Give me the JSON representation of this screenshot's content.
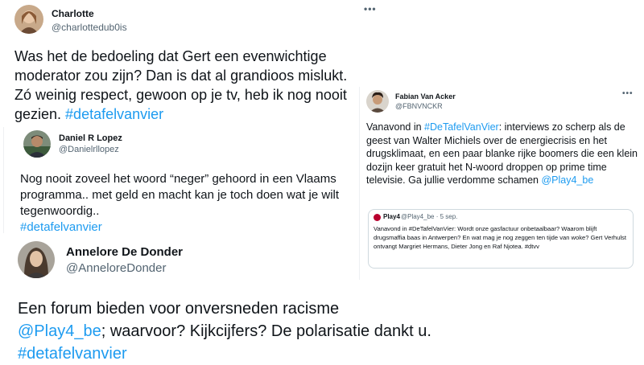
{
  "tweets": {
    "charlotte": {
      "name": "Charlotte",
      "handle": "@charlottedub0is",
      "more": "•••",
      "text_before": "Was het de bedoeling dat Gert een evenwichtige moderator zou zijn? Dan is dat al grandioos mislukt. Zó weinig respect, gewoon op je tv, heb ik nog nooit gezien. ",
      "hashtag": "#detafelvanvier"
    },
    "daniel": {
      "name": "Daniel R Lopez",
      "handle": "@Danielrllopez",
      "text_before": "Nog nooit zoveel het woord “neger” gehoord in een Vlaams programma.. met geld en macht kan je toch doen wat je wilt tegenwoordig..",
      "hashtag": "#detafelvanvier"
    },
    "annelore": {
      "name": "Annelore De Donder",
      "handle": "@AnneloreDonder",
      "text_before": "Een forum bieden voor onversneden racisme ",
      "mention": "@Play4_be",
      "text_after": "; waarvoor? Kijkcijfers? De polarisatie dankt u. ",
      "hashtag": "#detafelvanvier"
    },
    "fabian": {
      "name": "Fabian Van Acker",
      "handle": "@FBNVNCKR",
      "more": "•••",
      "text_before": "Vanavond in ",
      "hashtag": "#DeTafelVanVier",
      "text_middle": ": interviews zo scherp als de geest van Walter Michiels over de energiecrisis en het drugsklimaat, en een paar blanke rijke boomers die een klein dozijn keer gratuit het N-woord droppen op prime time televisie. Ga jullie verdomme schamen ",
      "mention": "@Play4_be",
      "quote": {
        "name": "Play4",
        "meta": "@Play4_be · 5 sep.",
        "text": "Vanavond in #DeTafelVanVier: Wordt onze gasfactuur onbetaalbaar? Waarom blijft drugsmaffia baas in Antwerpen? En wat mag je nog zeggen ten tijde van woke? Gert Verhulst ontvangt Margriet Hermans, Dieter Jong en Raf Njotea. #dtvv"
      }
    }
  },
  "colors": {
    "link": "#1d9bf0",
    "text": "#0f1419",
    "secondary": "#536471",
    "brand_play4": "#b8002e"
  }
}
